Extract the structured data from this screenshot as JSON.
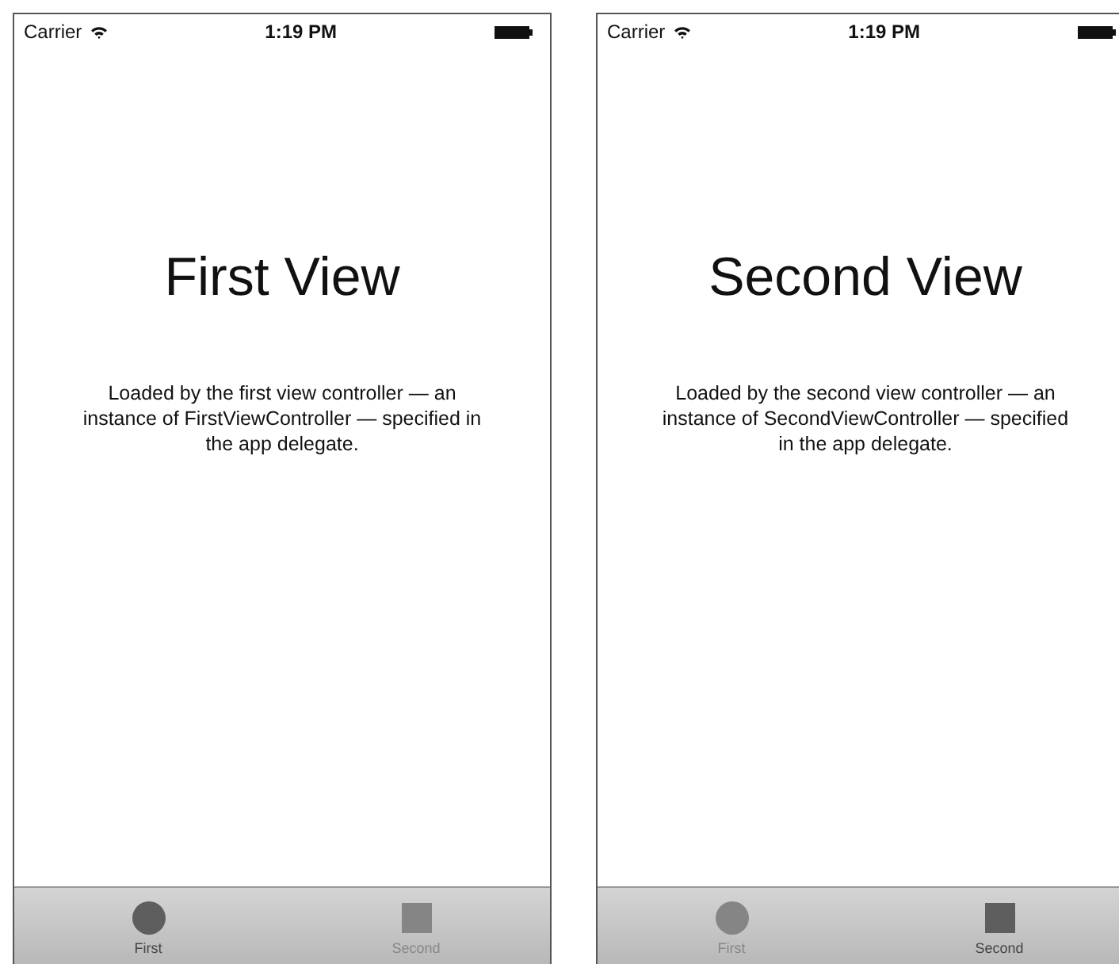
{
  "screens": [
    {
      "status": {
        "carrier": "Carrier",
        "time": "1:19 PM"
      },
      "title": "First View",
      "description": "Loaded by the first view controller — an instance of FirstViewController — specified in the app delegate.",
      "tabs": [
        {
          "label": "First",
          "kind": "circle",
          "selected": true
        },
        {
          "label": "Second",
          "kind": "square",
          "selected": false
        }
      ]
    },
    {
      "status": {
        "carrier": "Carrier",
        "time": "1:19 PM"
      },
      "title": "Second View",
      "description": "Loaded by the second view controller — an instance of SecondViewController — specified in the app delegate.",
      "tabs": [
        {
          "label": "First",
          "kind": "circle",
          "selected": false
        },
        {
          "label": "Second",
          "kind": "square",
          "selected": true
        }
      ]
    }
  ]
}
